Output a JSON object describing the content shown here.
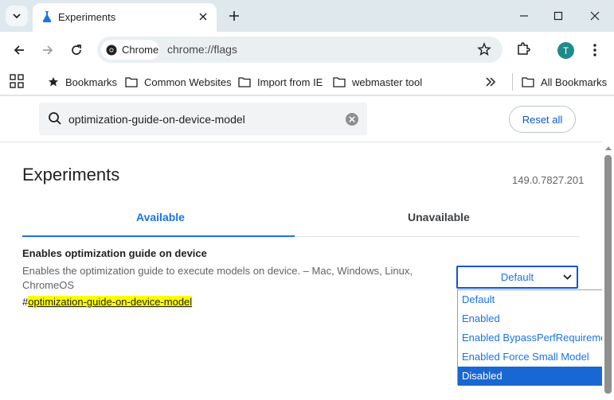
{
  "tab": {
    "title": "Experiments"
  },
  "omnibox": {
    "chip_label": "Chrome",
    "url": "chrome://flags"
  },
  "profile": {
    "initial": "T"
  },
  "bookmarks": [
    {
      "label": "Bookmarks",
      "icon": "star-icon"
    },
    {
      "label": "Common Websites",
      "icon": "folder-icon"
    },
    {
      "label": "Import from IE",
      "icon": "folder-icon"
    },
    {
      "label": "webmaster tool",
      "icon": "folder-icon"
    }
  ],
  "all_bookmarks": "All Bookmarks",
  "search": {
    "value": "optimization-guide-on-device-model"
  },
  "reset_label": "Reset all",
  "page_title": "Experiments",
  "version": "149.0.7827.201",
  "page_tabs": {
    "available": "Available",
    "unavailable": "Unavailable"
  },
  "flag": {
    "title": "Enables optimization guide on device",
    "description": "Enables the optimization guide to execute models on device. – Mac, Windows, Linux, ChromeOS",
    "hash": "#",
    "link": "optimization-guide-on-device-model",
    "selected": "Default",
    "options": [
      "Default",
      "Enabled",
      "Enabled BypassPerfRequirement",
      "Enabled Force Small Model",
      "Disabled"
    ]
  },
  "colors": {
    "accent": "#1a73e8",
    "highlight": "#ffff00",
    "frame": "#dfe8ec"
  }
}
